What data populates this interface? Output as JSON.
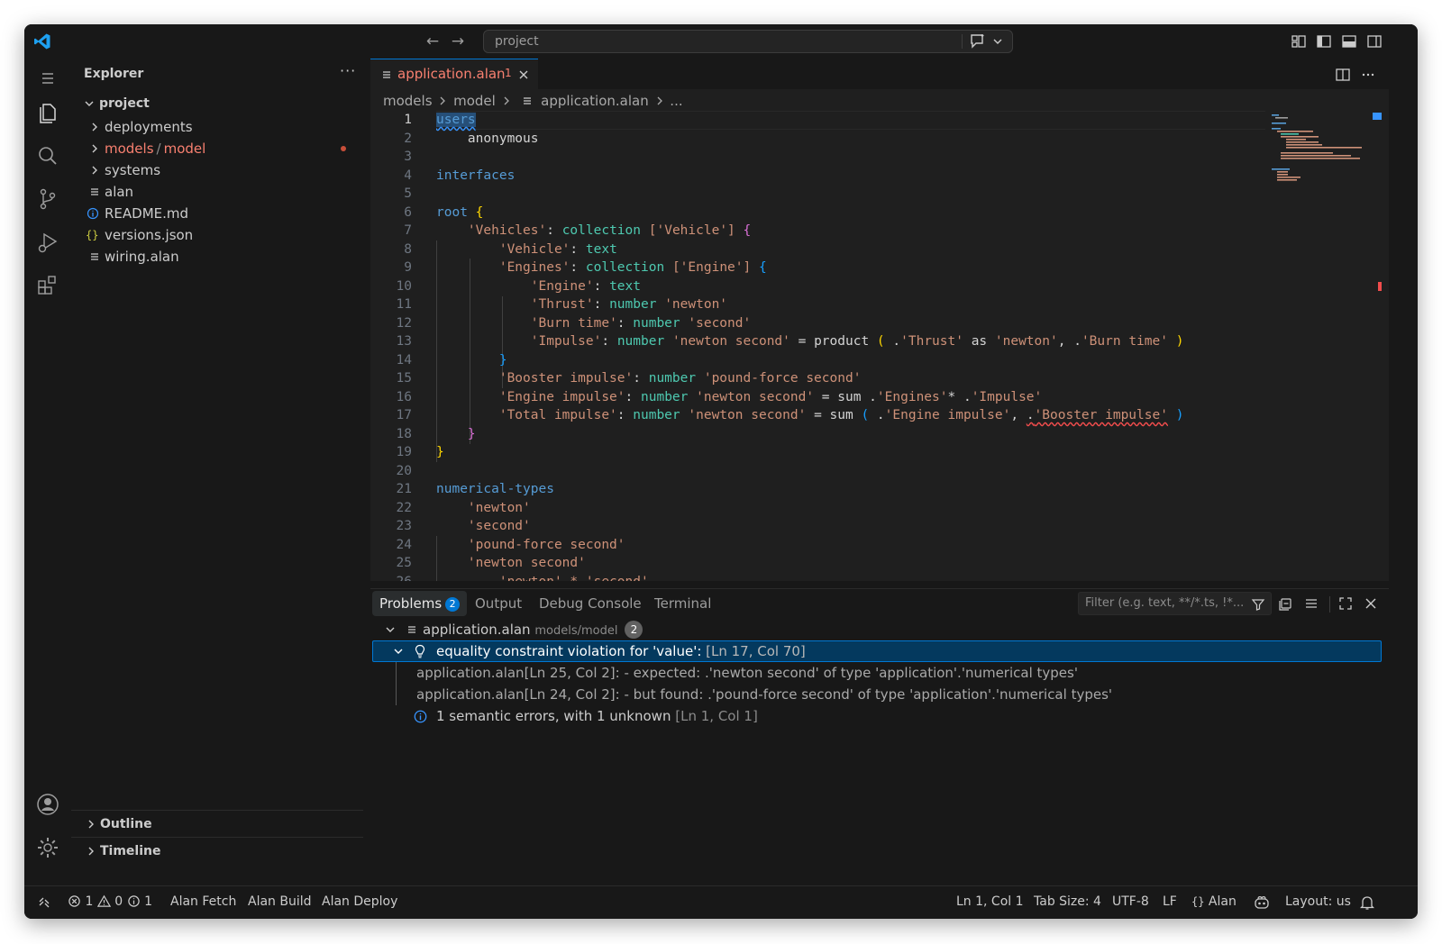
{
  "title_bar": {
    "command_center": "project"
  },
  "explorer": {
    "title": "Explorer",
    "more": "···",
    "root": "project",
    "items": [
      {
        "label": "deployments",
        "type": "folder",
        "color": "#cccccc"
      },
      {
        "label": "models",
        "label2": "model",
        "type": "folder",
        "color": "#f88070",
        "modified": true
      },
      {
        "label": "systems",
        "type": "folder",
        "color": "#cccccc"
      },
      {
        "label": "alan",
        "type": "file",
        "icon": "lines-icon",
        "color": "#cccccc"
      },
      {
        "label": "README.md",
        "type": "file",
        "icon": "info-icon",
        "color": "#cccccc"
      },
      {
        "label": "versions.json",
        "type": "file",
        "icon": "braces-icon",
        "color": "#cccccc"
      },
      {
        "label": "wiring.alan",
        "type": "file",
        "icon": "lines-icon",
        "color": "#cccccc"
      }
    ],
    "outline": "Outline",
    "timeline": "Timeline"
  },
  "editor": {
    "tab": {
      "name": "application.alan",
      "problems": "1"
    },
    "breadcrumb": {
      "part1": "models",
      "part2": "model",
      "part3": "application.alan",
      "part4": "..."
    },
    "current_line": "1"
  },
  "panel": {
    "tabs": {
      "problems": "Problems",
      "problems_count": "2",
      "output": "Output",
      "debug": "Debug Console",
      "terminal": "Terminal"
    },
    "filter_placeholder": "Filter (e.g. text, **/*.ts, !*...",
    "file": {
      "name": "application.alan",
      "path": "models/model",
      "count": "2"
    },
    "error": {
      "message": "equality constraint violation for 'value':",
      "location": "[Ln 17, Col 70]"
    },
    "related": [
      "application.alan[Ln 25, Col 2]: - expected: .'newton second' of type 'application'.'numerical types'",
      "application.alan[Ln 24, Col 2]: - but found: .'pound-force second' of type 'application'.'numerical types'"
    ],
    "info": {
      "message": "1 semantic errors, with 1 unknown",
      "location": "[Ln 1, Col 1]"
    }
  },
  "status_bar": {
    "errors": "1",
    "warnings": "0",
    "infos": "1",
    "fetch": "Alan Fetch",
    "build": "Alan Build",
    "deploy": "Alan Deploy",
    "position": "Ln 1, Col 1",
    "tab_size": "Tab Size: 4",
    "encoding": "UTF-8",
    "eol": "LF",
    "language": "Alan",
    "layout": "Layout: us"
  },
  "colors": {
    "accent": "#0078d4",
    "error": "#f88070",
    "background": "#1f1f1f"
  }
}
